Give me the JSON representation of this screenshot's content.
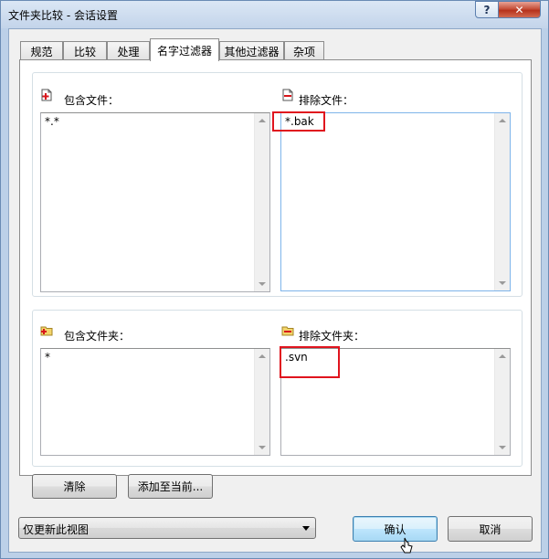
{
  "window": {
    "title": "文件夹比较 - 会话设置"
  },
  "tabs": [
    {
      "label": "规范"
    },
    {
      "label": "比较"
    },
    {
      "label": "处理"
    },
    {
      "label": "名字过滤器",
      "active": true
    },
    {
      "label": "其他过滤器"
    },
    {
      "label": "杂项"
    }
  ],
  "filters": {
    "include_files": {
      "label": "包含文件：",
      "value": "*.*"
    },
    "exclude_files": {
      "label": "排除文件：",
      "value": "*.bak"
    },
    "include_folders": {
      "label": "包含文件夹：",
      "value": "*"
    },
    "exclude_folders": {
      "label": "排除文件夹：",
      "value": ".svn"
    }
  },
  "buttons": {
    "clear": "清除",
    "add_to_current": "添加至当前...",
    "ok": "确认",
    "cancel": "取消"
  },
  "view_scope": {
    "selected": "仅更新此视图"
  },
  "colors": {
    "highlight": "#e0141e",
    "focus_border": "#7eb4ea"
  }
}
